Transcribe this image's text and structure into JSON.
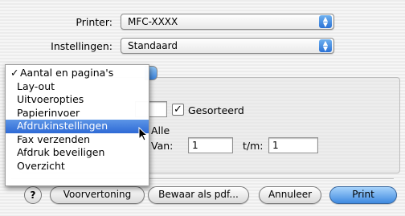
{
  "printer": {
    "label": "Printer:",
    "value": "MFC-XXXX"
  },
  "presets": {
    "label": "Instellingen:",
    "value": "Standaard"
  },
  "copies": {
    "collated_label": "Gesorteerd",
    "collated_checked": true,
    "checkmark": "✓"
  },
  "pages": {
    "all_label": "Alle",
    "from_label": "Van:",
    "from_value": "1",
    "to_label": "t/m:",
    "to_value": "1"
  },
  "menu": {
    "check_glyph": "✓",
    "items": [
      {
        "label": "Aantal en pagina's",
        "checked": true
      },
      {
        "label": "Lay-out"
      },
      {
        "label": "Uitvoeropties"
      },
      {
        "label": "Papierinvoer"
      },
      {
        "label": "Afdrukinstellingen",
        "highlighted": true
      },
      {
        "label": "Fax verzenden"
      },
      {
        "label": "Afdruk beveiligen"
      },
      {
        "label": "Overzicht"
      }
    ]
  },
  "buttons": {
    "help": "?",
    "preview": "Voorvertoning",
    "save_pdf": "Bewaar als pdf...",
    "cancel": "Annuleer",
    "print": "Print"
  },
  "colors": {
    "highlight": "#2e6ad6",
    "accent_button": "#3f8ae0"
  }
}
